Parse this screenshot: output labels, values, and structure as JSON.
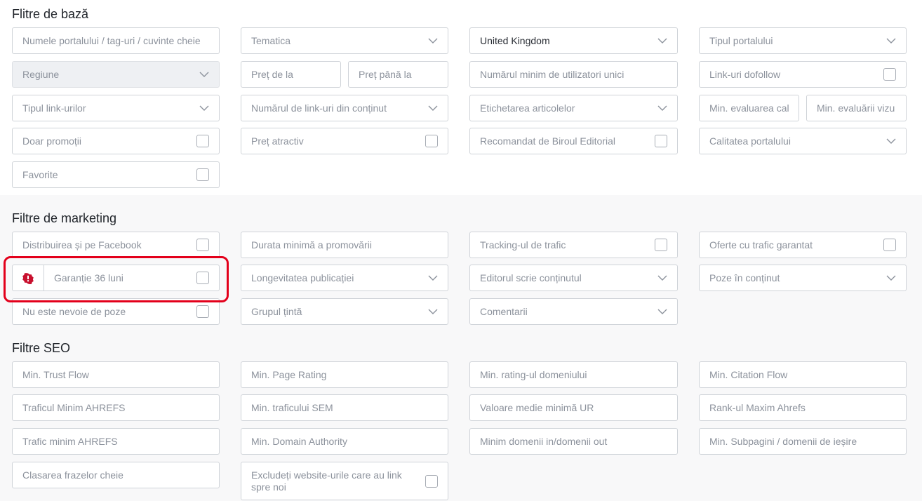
{
  "sections": {
    "basic": "Flitre de bază",
    "marketing": "Filtre de marketing",
    "seo": "Filtre SEO"
  },
  "basic": {
    "portal_search": "Numele portalului / tag-uri / cuvinte cheie",
    "thematic": "Tematica",
    "country": "United Kingdom",
    "portal_type": "Tipul portalului",
    "region": "Regiune",
    "price_from": "Preț de la",
    "price_to": "Preț până la",
    "min_unique_users": "Numărul minim de utilizatori unici",
    "dofollow_links": "Link-uri dofollow",
    "link_type": "Tipul link-urilor",
    "content_links_count": "Numărul de link-uri din conținut",
    "article_tagging": "Etichetarea articolelor",
    "min_quality_rating": "Min. evaluarea cal",
    "min_visual_rating": "Min. evaluării vizu",
    "promotions_only": "Doar promoții",
    "attractive_price": "Preț atractiv",
    "editorial_recommended": "Recomandat de Biroul Editorial",
    "portal_quality": "Calitatea portalului",
    "favorites": "Favorite"
  },
  "marketing": {
    "facebook_distribution": "Distribuirea și pe Facebook",
    "min_promotion_duration": "Durata minimă a promovării",
    "traffic_tracking": "Tracking-ul de trafic",
    "guaranteed_traffic": "Oferte cu trafic garantat",
    "guarantee_36": "Garanție 36 luni",
    "publication_longevity": "Longevitatea publicației",
    "editor_writes": "Editorul scrie conținutul",
    "content_images": "Poze în conținut",
    "no_images_needed": "Nu este nevoie de poze",
    "target_group": "Grupul țintă",
    "comments": "Comentarii"
  },
  "seo": {
    "min_trust_flow": "Min. Trust Flow",
    "min_page_rating": "Min. Page Rating",
    "min_domain_rating": "Min. rating-ul domeniului",
    "min_citation_flow": "Min. Citation Flow",
    "min_ahrefs_traffic": "Traficul Minim AHREFS",
    "min_sem_traffic": "Min. traficului SEM",
    "min_avg_ur": "Valoare medie minimă UR",
    "max_ahrefs_rank": "Rank-ul Maxim Ahrefs",
    "min_ahrefs_traffic_2": "Trafic minim AHREFS",
    "min_domain_authority": "Min. Domain Authority",
    "min_domains_in_out": "Minim domenii in/domenii out",
    "min_subpages_out": "Min. Subpagini / domenii de ieșire",
    "keyword_ranking": "Clasarea frazelor cheie",
    "exclude_linking": "Excludeți website-urile care au link spre noi"
  },
  "colors": {
    "highlight": "#e3001b",
    "warning_icon": "#c8102e"
  }
}
